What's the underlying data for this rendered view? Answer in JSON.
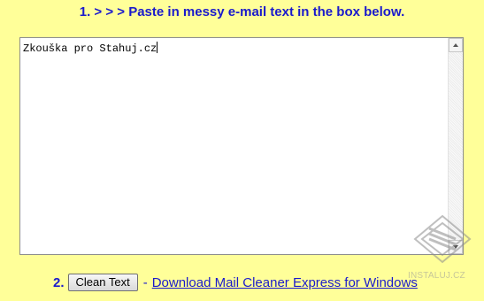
{
  "step1": {
    "text": "1. > > > Paste in messy e-mail text in the box below."
  },
  "textbox": {
    "value": "Zkouška pro Stahuj.cz"
  },
  "step2": {
    "number": "2.",
    "button_label": "Clean Text",
    "separator": "-",
    "link_text": "Download Mail Cleaner Express for Windows"
  },
  "watermark": {
    "text": "INSTALUJ.CZ"
  },
  "colors": {
    "background": "#FFFF99",
    "heading": "#1A1ACC",
    "link": "#1A1ACC"
  },
  "icons": {
    "scroll_up": "chevron-up-icon",
    "scroll_down": "chevron-down-icon",
    "watermark_logo": "instaluj-logo-icon"
  }
}
